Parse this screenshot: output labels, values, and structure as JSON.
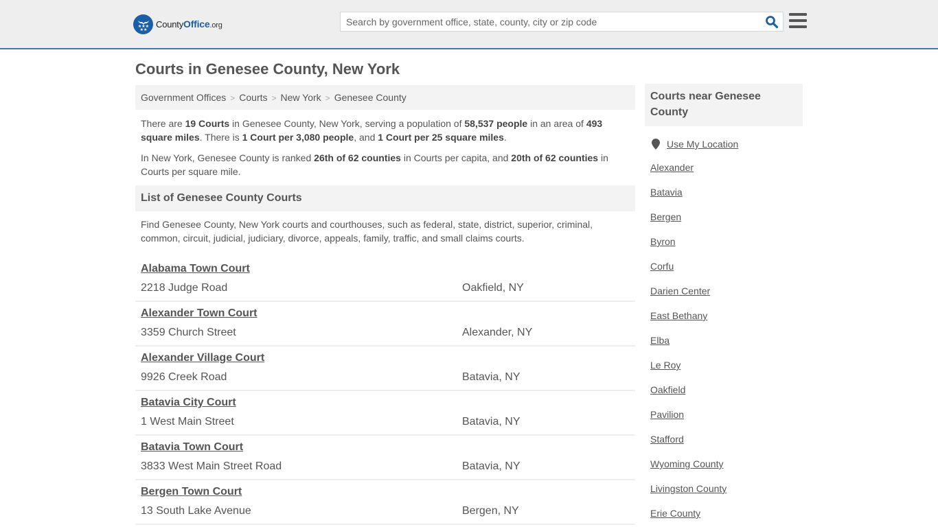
{
  "header": {
    "logo": {
      "county": "County",
      "office": "Office",
      "org": ".org"
    },
    "search": {
      "placeholder": "Search by government office, state, county, city or zip code",
      "value": ""
    },
    "brand_color": "#1a5fa8"
  },
  "page": {
    "title": "Courts in Genesee County, New York"
  },
  "breadcrumb": [
    {
      "label": "Government Offices"
    },
    {
      "label": "Courts"
    },
    {
      "label": "New York"
    },
    {
      "label": "Genesee County"
    }
  ],
  "intro": {
    "p1": {
      "t1": "There are ",
      "b1": "19 Courts",
      "t2": " in Genesee County, New York, serving a population of ",
      "b2": "58,537 people",
      "t3": " in an area of ",
      "b3": "493 square miles",
      "t4": ". There is ",
      "b4": "1 Court per 3,080 people",
      "t5": ", and ",
      "b5": "1 Court per 25 square miles",
      "t6": "."
    },
    "p2": {
      "t1": "In New York, Genesee County is ranked ",
      "b1": "26th of 62 counties",
      "t2": " in Courts per capita, and ",
      "b2": "20th of 62 counties",
      "t3": " in Courts per square mile."
    }
  },
  "list": {
    "header": "List of Genesee County Courts",
    "description": "Find Genesee County, New York courts and courthouses, such as federal, state, district, superior, criminal, common, circuit, judicial, judiciary, divorce, appeals, family, traffic, and small claims courts.",
    "courts": [
      {
        "name": "Alabama Town Court",
        "address": "2218 Judge Road",
        "city": "Oakfield, NY"
      },
      {
        "name": "Alexander Town Court",
        "address": "3359 Church Street",
        "city": "Alexander, NY"
      },
      {
        "name": "Alexander Village Court",
        "address": "9926 Creek Road",
        "city": "Batavia, NY"
      },
      {
        "name": "Batavia City Court",
        "address": "1 West Main Street",
        "city": "Batavia, NY"
      },
      {
        "name": "Batavia Town Court",
        "address": "3833 West Main Street Road",
        "city": "Batavia, NY"
      },
      {
        "name": "Bergen Town Court",
        "address": "13 South Lake Avenue",
        "city": "Bergen, NY"
      }
    ]
  },
  "sidebar": {
    "header": "Courts near Genesee County",
    "use_location": "Use My Location",
    "links": [
      "Alexander",
      "Batavia",
      "Bergen",
      "Byron",
      "Corfu",
      "Darien Center",
      "East Bethany",
      "Elba",
      "Le Roy",
      "Oakfield",
      "Pavilion",
      "Stafford",
      "Wyoming County",
      "Livingston County",
      "Erie County"
    ]
  }
}
